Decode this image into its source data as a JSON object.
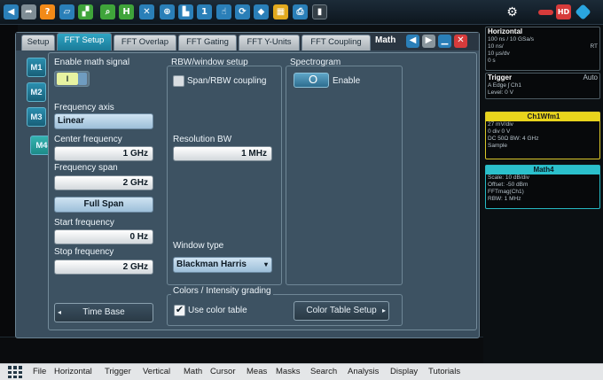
{
  "toolbar": {
    "icons": [
      "back-icon",
      "redo-icon",
      "help-icon",
      "autoset-icon",
      "pattern-icon",
      "zoom-icon",
      "history-icon",
      "measure-icon",
      "zoom-window-icon",
      "marker-icon",
      "cursor-icon",
      "touch-icon",
      "trigger-icon",
      "mask-icon",
      "print-icon",
      "delete-icon"
    ],
    "right_icons": [
      "settings-icon",
      "signal-icon",
      "hd-icon",
      "network-icon"
    ]
  },
  "dialog": {
    "title": "Math",
    "tabs": [
      "Setup",
      "FFT Setup",
      "FFT Overlap",
      "FFT Gating",
      "FFT Y-Units",
      "FFT Coupling"
    ],
    "active_tab": "FFT Setup",
    "math_tabs": [
      "M1",
      "M2",
      "M3",
      "M4"
    ],
    "active_math": "M4"
  },
  "fft": {
    "enable_label": "Enable math signal",
    "enable_value": "I",
    "freq_axis_label": "Frequency axis",
    "freq_axis_value": "Linear",
    "center_label": "Center frequency",
    "center_value": "1 GHz",
    "span_label": "Frequency span",
    "span_value": "2 GHz",
    "full_span": "Full Span",
    "start_label": "Start frequency",
    "start_value": "0 Hz",
    "stop_label": "Stop frequency",
    "stop_value": "2 GHz",
    "time_base": "Time Base"
  },
  "rbw": {
    "header": "RBW/window setup",
    "coupling_label": "Span/RBW coupling",
    "res_label": "Resolution BW",
    "res_value": "1 MHz",
    "window_label": "Window type",
    "window_value": "Blackman Harris"
  },
  "spectrogram": {
    "header": "Spectrogram",
    "enable_label": "Enable"
  },
  "colors": {
    "header": "Colors / Intensity grading",
    "use_table": "Use color table",
    "table_setup": "Color Table Setup"
  },
  "right": {
    "horizontal": {
      "title": "Horizontal",
      "lines": [
        "100 ns / 10 GSa/s",
        "10 ns/",
        "10 µs/dv",
        "0 s"
      ],
      "tag": "RT"
    },
    "trigger": {
      "title": "Trigger",
      "tag": "Auto",
      "lines": [
        "A   Edge  ʃ  Ch1",
        "Level: 0 V"
      ]
    },
    "ch1": {
      "title": "Ch1Wfm1",
      "lines": [
        "27 mV/div",
        "0 div        0 V",
        "DC 50Ω      BW: 4 GHz",
        "Sample"
      ]
    },
    "math4": {
      "title": "Math4",
      "lines": [
        "Scale: 10 dB/div",
        "Offset: -50 dBm",
        "FFTmag(Ch1)",
        "RBW: 1 MHz"
      ]
    }
  },
  "menubar": {
    "items": [
      "File",
      "Horizontal",
      "Trigger",
      "Vertical",
      "Math",
      "Cursor",
      "Meas",
      "Masks",
      "Search",
      "Analysis",
      "Display",
      "Tutorials"
    ]
  }
}
